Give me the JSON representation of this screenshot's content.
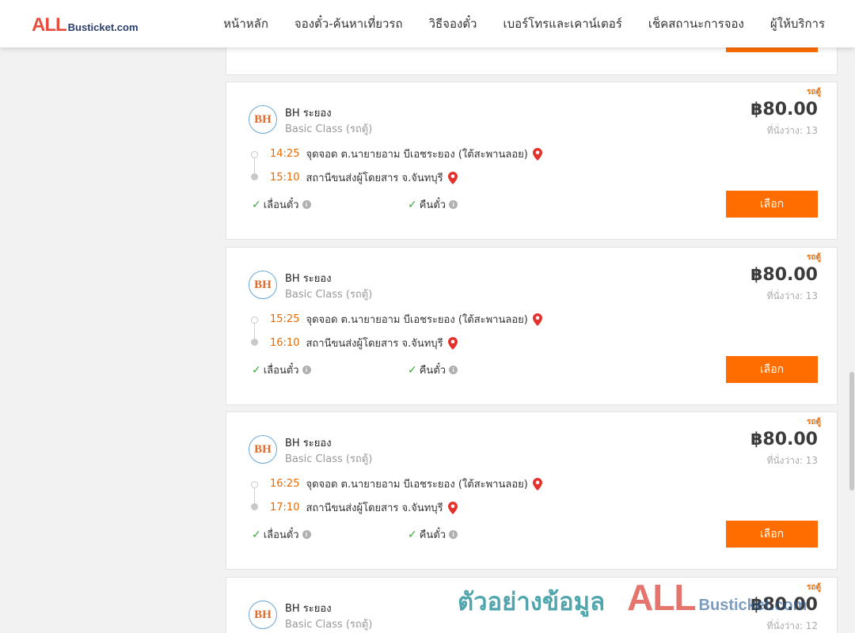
{
  "header": {
    "logo_main": "ALL",
    "logo_sub": "Busticket.com",
    "nav": [
      "หน้าหลัก",
      "จองตั๋ว-ค้นหาเที่ยวรถ",
      "วิธีจองตั๋ว",
      "เบอร์โทรและเคาน์เตอร์",
      "เช็คสถานะการจอง",
      "ผู้ให้บริการ"
    ]
  },
  "trips": [
    {
      "tag": "รถตู้",
      "logo": "BH",
      "operator": "BH ระยอง",
      "class": "Basic Class (รถตู้)",
      "price": "฿80.00",
      "seats": "ที่นั่งว่าง: 13",
      "dep_time": "14:25",
      "dep_place": "จุดจอด ต.นายายอาม บีเอชระยอง (ใต้สะพานลอย)",
      "arr_time": "15:10",
      "arr_place": "สถานีขนส่งผู้โดยสาร จ.จันทบุรี",
      "feature1": "เลื่อนตั๋ว",
      "feature2": "คืนตั๋ว",
      "button": "เลือก"
    },
    {
      "tag": "รถตู้",
      "logo": "BH",
      "operator": "BH ระยอง",
      "class": "Basic Class (รถตู้)",
      "price": "฿80.00",
      "seats": "ที่นั่งว่าง: 13",
      "dep_time": "15:25",
      "dep_place": "จุดจอด ต.นายายอาม บีเอชระยอง (ใต้สะพานลอย)",
      "arr_time": "16:10",
      "arr_place": "สถานีขนส่งผู้โดยสาร จ.จันทบุรี",
      "feature1": "เลื่อนตั๋ว",
      "feature2": "คืนตั๋ว",
      "button": "เลือก"
    },
    {
      "tag": "รถตู้",
      "logo": "BH",
      "operator": "BH ระยอง",
      "class": "Basic Class (รถตู้)",
      "price": "฿80.00",
      "seats": "ที่นั่งว่าง: 13",
      "dep_time": "16:25",
      "dep_place": "จุดจอด ต.นายายอาม บีเอชระยอง (ใต้สะพานลอย)",
      "arr_time": "17:10",
      "arr_place": "สถานีขนส่งผู้โดยสาร จ.จันทบุรี",
      "feature1": "เลื่อนตั๋ว",
      "feature2": "คืนตั๋ว",
      "button": "เลือก"
    },
    {
      "tag": "รถตู้",
      "logo": "BH",
      "operator": "BH ระยอง",
      "class": "Basic Class (รถตู้)",
      "price": "฿80.00",
      "seats": "ที่นั่งว่าง: 12"
    }
  ],
  "watermark": {
    "text": "ตัวอย่างข้อมูล",
    "logo_main": "ALL",
    "logo_sub": "Busticket.com"
  },
  "colors": {
    "accent": "#ff6d00",
    "time": "#e86a00",
    "check": "#3aa53a"
  }
}
